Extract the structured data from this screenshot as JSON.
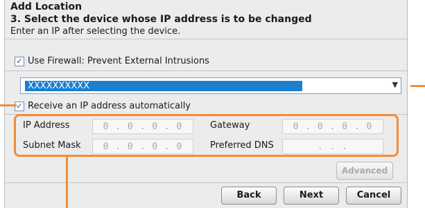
{
  "dialog": {
    "title": "Add Location",
    "heading": "3. Select the device whose IP address is to be changed",
    "subtext": "Enter an IP after selecting the device."
  },
  "firewall": {
    "checked": true,
    "label": "Use Firewall: Prevent External Intrusions"
  },
  "device_select": {
    "selected": "XXXXXXXXXX"
  },
  "auto_ip": {
    "checked": true,
    "label": "Receive an IP address automatically"
  },
  "network": {
    "ip_address_label": "IP Address",
    "ip_address_value": "0 . 0 . 0 . 0",
    "gateway_label": "Gateway",
    "gateway_value": "0 . 0 . 0 . 0",
    "subnet_mask_label": "Subnet Mask",
    "subnet_mask_value": "0 . 0 . 0 . 0",
    "preferred_dns_label": "Preferred DNS",
    "preferred_dns_value": ". . ."
  },
  "buttons": {
    "advanced": "Advanced",
    "back": "Back",
    "next": "Next",
    "cancel": "Cancel"
  },
  "colors": {
    "accent": "#f28c38",
    "selection": "#1b7fd0"
  }
}
